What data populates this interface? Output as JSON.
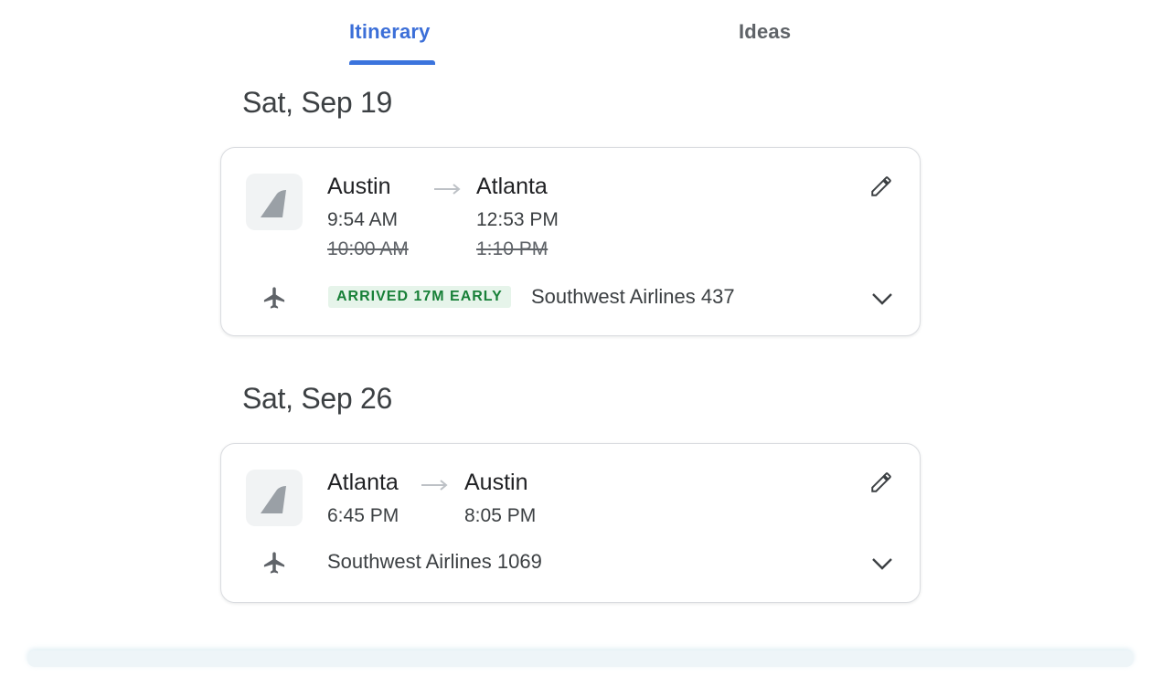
{
  "tabs": {
    "itinerary": "Itinerary",
    "ideas": "Ideas",
    "active": "Itinerary"
  },
  "colors": {
    "accent": "#3b74dd",
    "status_green": "#188038",
    "status_bg": "#e6f4ea"
  },
  "days": [
    {
      "date": "Sat, Sep 19",
      "flight": {
        "from_city": "Austin",
        "to_city": "Atlanta",
        "depart_time": "9:54 AM",
        "arrive_time": "12:53 PM",
        "depart_time_original": "10:00 AM",
        "arrive_time_original": "1:10 PM",
        "status": "ARRIVED 17M EARLY",
        "flight_name": "Southwest Airlines 437",
        "logo_icon": "southwest-tail-logo-icon",
        "type_icon": "airplane-icon"
      }
    },
    {
      "date": "Sat, Sep 26",
      "flight": {
        "from_city": "Atlanta",
        "to_city": "Austin",
        "depart_time": "6:45 PM",
        "arrive_time": "8:05 PM",
        "flight_name": "Southwest Airlines 1069",
        "logo_icon": "southwest-tail-logo-icon",
        "type_icon": "airplane-icon"
      }
    }
  ]
}
